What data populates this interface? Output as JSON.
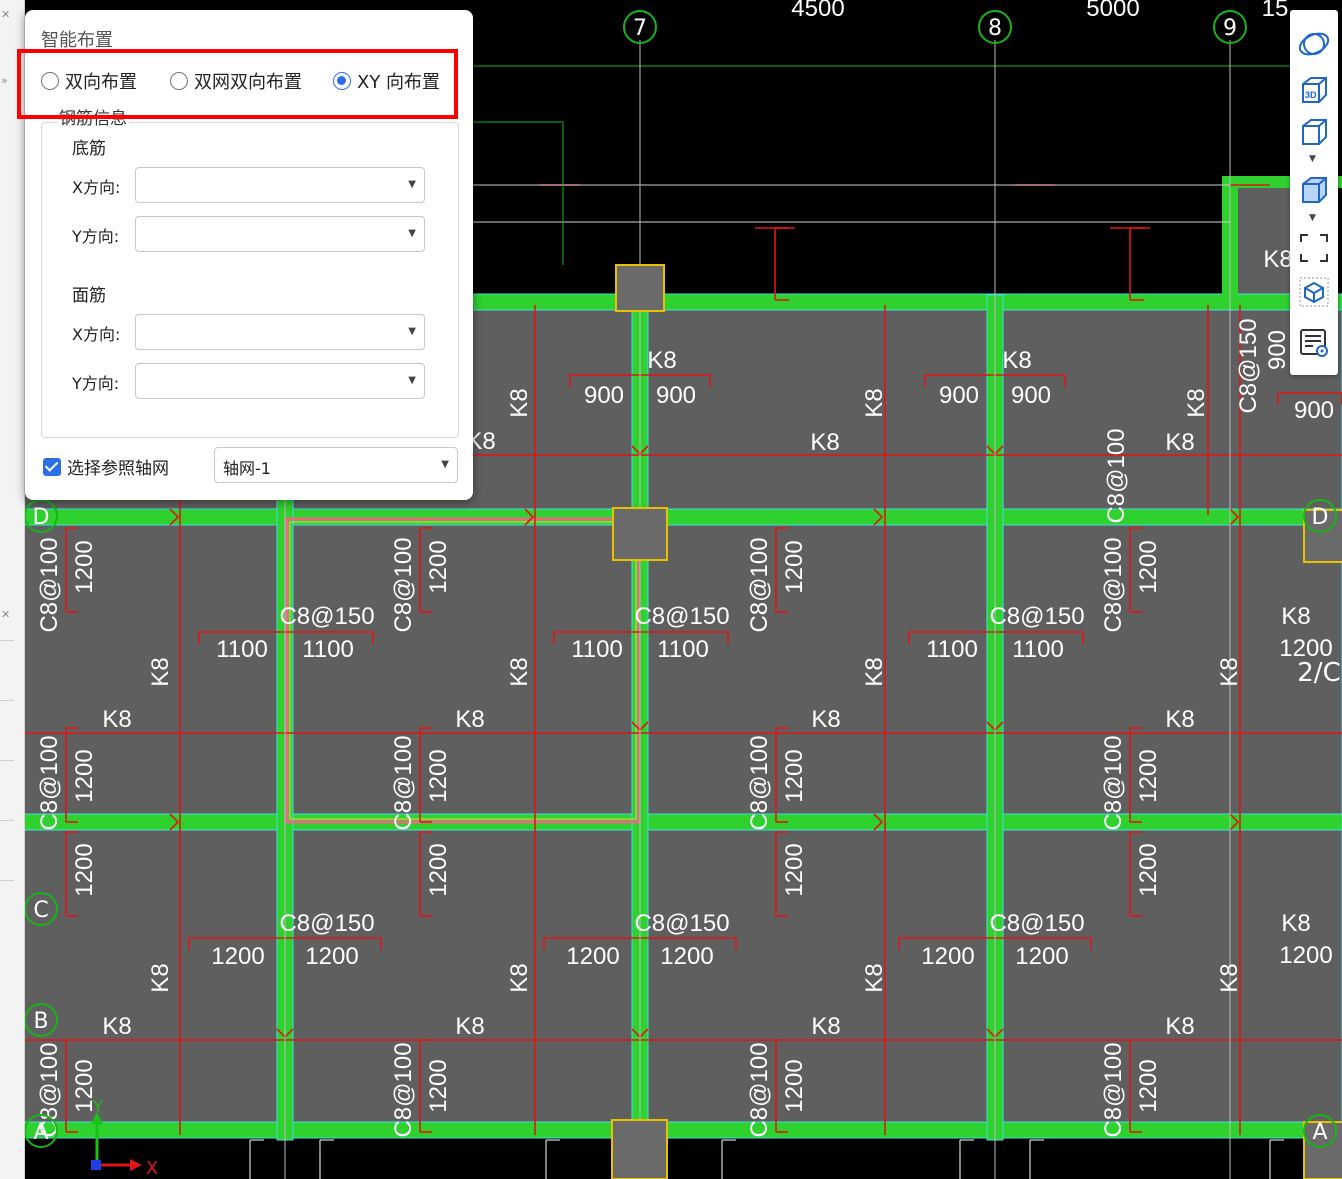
{
  "dialog": {
    "title": "智能布置",
    "modes": [
      {
        "label": "双向布置",
        "checked": false
      },
      {
        "label": "双网双向布置",
        "checked": false
      },
      {
        "label": "XY 向布置",
        "checked": true
      }
    ],
    "rebar_info_label": "钢筋信息",
    "bottom": {
      "label": "底筋",
      "x_label": "X方向:",
      "x_value": "",
      "y_label": "Y方向:",
      "y_value": ""
    },
    "top": {
      "label": "面筋",
      "x_label": "X方向:",
      "x_value": "",
      "y_label": "Y方向:",
      "y_value": ""
    },
    "ref_grid_label": "选择参照轴网",
    "ref_grid_checked": true,
    "ref_grid_value": "轴网-1"
  },
  "toolbar": {
    "buttons": [
      "orbit-icon",
      "view-3d-icon",
      "box-wire-icon",
      "box-solid-icon",
      "zoom-extents-icon",
      "view-cube-icon",
      "properties-list-icon"
    ]
  },
  "cad": {
    "dims": [
      "4500",
      "5000",
      "15"
    ],
    "axes_v": [
      "7",
      "8",
      "9"
    ],
    "axes_h": [
      "D",
      "C",
      "B",
      "A"
    ],
    "axis_2c": "2/C",
    "labels": [
      "K8",
      "900",
      "1100",
      "1200",
      "C8@100",
      "C8@150"
    ],
    "ucs_x": "X",
    "ucs_y": "Y",
    "colors": {
      "beam": "#2ed12e",
      "slab": "#5f5f5f",
      "rebar": "#e01616",
      "grid": "#d0d0d0",
      "text": "#ffffff"
    }
  }
}
